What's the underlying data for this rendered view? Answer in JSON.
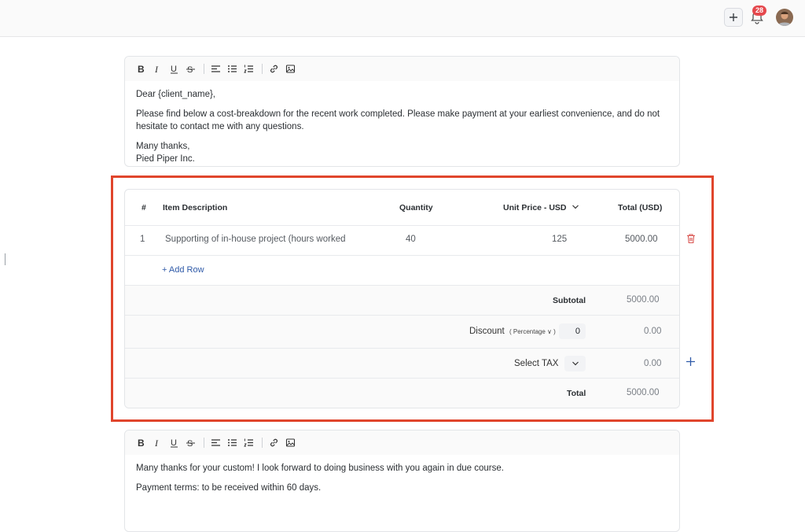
{
  "header": {
    "notification_count": "28",
    "icons": [
      "plus-icon",
      "bell-icon",
      "avatar"
    ],
    "badge_color": "#e5484d"
  },
  "intro_editor": {
    "toolbar": [
      "bold",
      "italic",
      "underline",
      "strikethrough",
      "align-left",
      "bulleted-list",
      "numbered-list",
      "link",
      "image"
    ],
    "lines": {
      "greeting": "Dear {client_name},",
      "body": "Please find below a cost-breakdown for the recent work completed. Please make payment at your earliest convenience, and do not hesitate to contact me with any questions.",
      "signoff": "Many thanks,",
      "company": "Pied Piper Inc."
    }
  },
  "items_table": {
    "highlight_color": "#e0452c",
    "headers": {
      "number": "#",
      "description": "Item Description",
      "quantity": "Quantity",
      "unit_price": "Unit Price - USD",
      "total": "Total  (USD)"
    },
    "rows": [
      {
        "number": "1",
        "description": "Supporting of in-house project (hours worked",
        "quantity": "40",
        "unit_price": "125",
        "total": "5000.00"
      }
    ],
    "add_row_label": "+ Add Row",
    "subtotal_label": "Subtotal",
    "subtotal_value": "5000.00",
    "discount_label": "Discount",
    "discount_type": "( Percentage ∨ )",
    "discount_input": "0",
    "discount_value": "0.00",
    "tax_label": "Select TAX",
    "tax_value": "0.00",
    "total_label": "Total",
    "total_value": "5000.00",
    "accent_color": "#2f5aa8"
  },
  "outro_editor": {
    "lines": {
      "thanks": "Many thanks for your custom! I look forward to doing business with you again in due course.",
      "terms": "Payment terms: to be received within 60 days."
    }
  }
}
